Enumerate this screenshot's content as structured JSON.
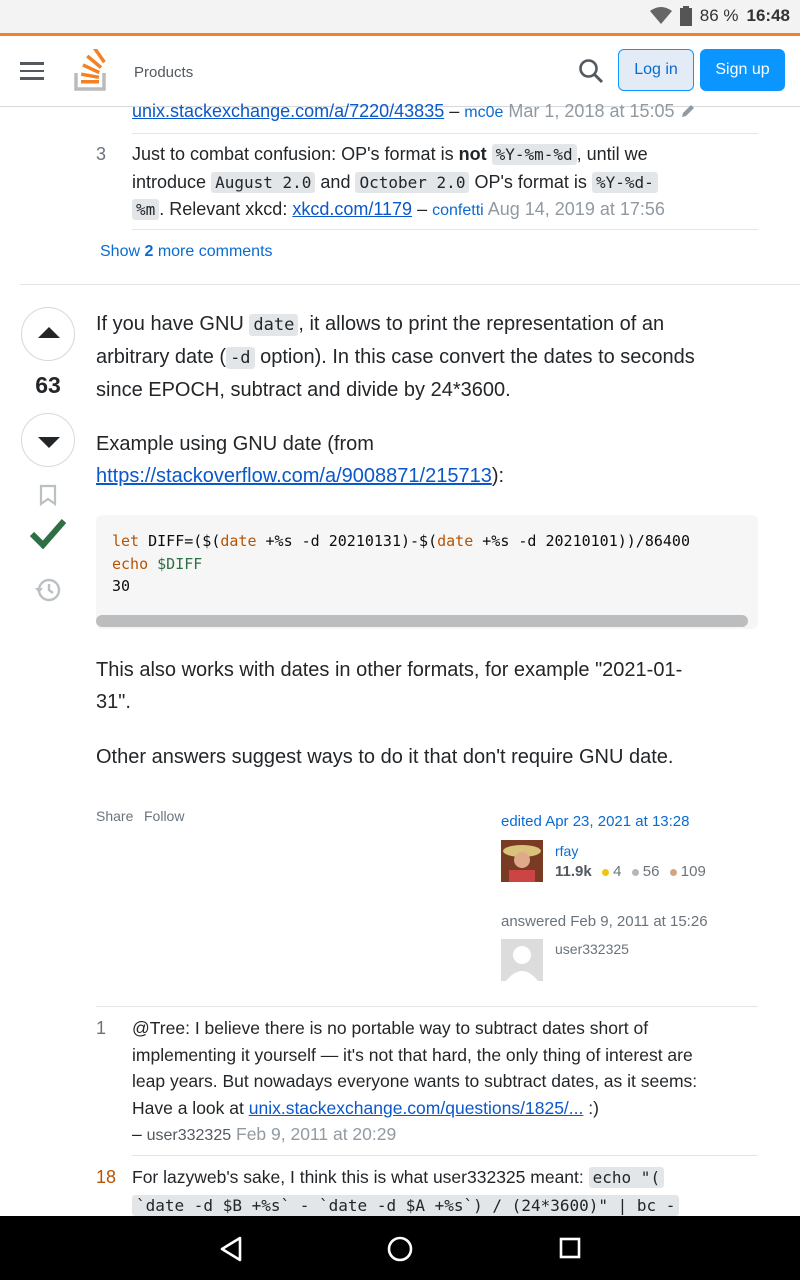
{
  "status": {
    "battery": "86 %",
    "time": "16:48"
  },
  "header": {
    "products": "Products",
    "login": "Log in",
    "signup": "Sign up"
  },
  "comments_top": [
    {
      "link": "unix.stackexchange.com/a/7220/43835",
      "dash": "–",
      "user": "mc0e",
      "time": "Mar 1, 2018 at 15:05"
    },
    {
      "score": "3",
      "t1": "Just to combat confusion: OP's format is ",
      "bold": "not",
      "c1": "%Y-%m-%d",
      "t2": ", until we",
      "t3": "introduce",
      "c2": "August 2.0",
      "t4": "and",
      "c3": "October 2.0",
      "t5": "OP's format is",
      "c4a": "%Y-%d-",
      "c4b": "%m",
      "t6": ". Relevant xkcd:",
      "link": "xkcd.com/1179",
      "dash": "–",
      "user": "confetti",
      "time": "Aug 14, 2019 at 17:56"
    }
  ],
  "show_more": {
    "pre": "Show ",
    "count": "2",
    "post": " more comments"
  },
  "answer": {
    "score": "63",
    "p1a": "If you have GNU ",
    "p1code": "date",
    "p1b": ", it allows to print the representation of an",
    "p1c": "arbitrary date (",
    "p1code2": "-d",
    "p1d": " option). In this case convert the dates to seconds",
    "p1e": "since EPOCH, subtract and divide by 24*3600.",
    "p2a": "Example using GNU date (from",
    "p2link": "https://stackoverflow.com/a/9008871/215713",
    "p2b": "):",
    "code_l1_kw": "let",
    "code_l1a": " DIFF=($(",
    "code_l1_kw2": "date",
    "code_l1b": " +%s -d 20210131)-$(",
    "code_l1_kw3": "date",
    "code_l1c": " +%s -d 20210101))/86400",
    "code_l2_kw": "echo",
    "code_l2_var": " $DIFF",
    "code_l3": "30",
    "p3a": "This also works with dates in other formats, for example \"2021-01-",
    "p3b": "31\".",
    "p4": "Other answers suggest ways to do it that don't require GNU date.",
    "share": "Share",
    "follow": "Follow",
    "edited": "edited Apr 23, 2021 at 13:28",
    "editor": {
      "name": "rfay",
      "rep": "11.9k",
      "gold": "4",
      "silver": "56",
      "bronze": "109"
    },
    "answered": "answered Feb 9, 2011 at 15:26",
    "author": "user332325"
  },
  "comments_bottom": [
    {
      "score": "1",
      "l1": "@Tree: I believe there is no portable way to subtract dates short of",
      "l2": "implementing it yourself — it's not that hard, the only thing of interest are",
      "l3": "leap years. But nowadays everyone wants to subtract dates, as it seems:",
      "l4a": "Have a look at ",
      "link": "unix.stackexchange.com/questions/1825/...",
      "l4b": " :)",
      "dash": "–",
      "user": "user332325",
      "time": "Feb 9, 2011 at 20:29"
    },
    {
      "score": "18",
      "l1": "For lazyweb's sake, I think this is what user332325 meant:",
      "c1": "echo \"(",
      "c2": "`date -d $B +%s` - `date -d $A +%s`) / (24*3600)\" | bc -"
    }
  ],
  "colors": {
    "accent": "#f48225",
    "link": "#0a58ca",
    "accepted": "#2f6f44",
    "primary_button": "#0a95ff"
  }
}
